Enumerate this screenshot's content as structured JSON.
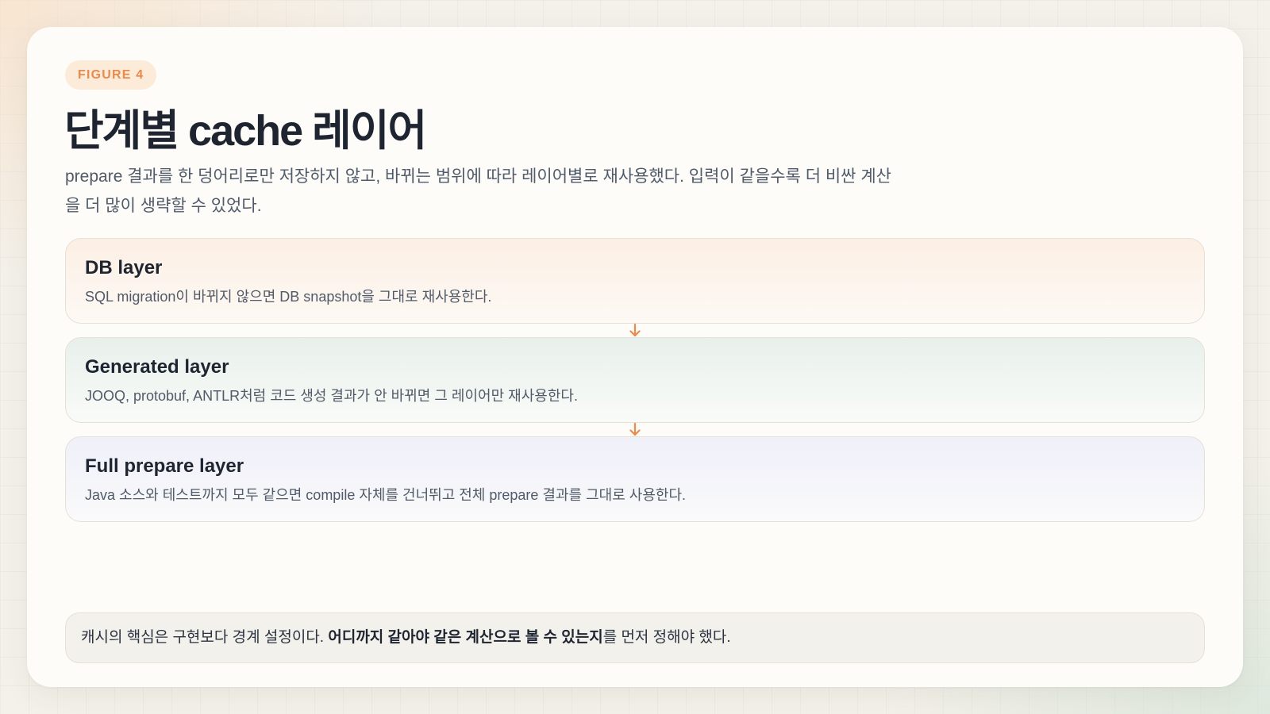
{
  "badge": "FIGURE 4",
  "title": "단계별 cache 레이어",
  "subtitle": "prepare 결과를 한 덩어리로만 저장하지 않고, 바뀌는 범위에 따라 레이어별로 재사용했다. 입력이 같을수록 더 비싼 계산을 더 많이 생략할 수 있었다.",
  "layers": [
    {
      "title": "DB layer",
      "description": "SQL migration이 바뀌지 않으면 DB snapshot을 그대로 재사용한다."
    },
    {
      "title": "Generated layer",
      "description": "JOOQ, protobuf, ANTLR처럼 코드 생성 결과가 안 바뀌면 그 레이어만 재사용한다."
    },
    {
      "title": "Full prepare layer",
      "description": "Java 소스와 테스트까지 모두 같으면 compile 자체를 건너뛰고 전체 prepare 결과를 그대로 사용한다."
    }
  ],
  "connector_icon": "arrow-down-icon",
  "footer": {
    "prefix": "캐시의 핵심은 구현보다 경계 설정이다. ",
    "emphasis": "어디까지 같아야 같은 계산으로 볼 수 있는지",
    "suffix": "를 먼저 정해야 했다."
  },
  "colors": {
    "accent": "#ea8a4c",
    "title": "#1e2430",
    "body": "#4f5a6a"
  }
}
